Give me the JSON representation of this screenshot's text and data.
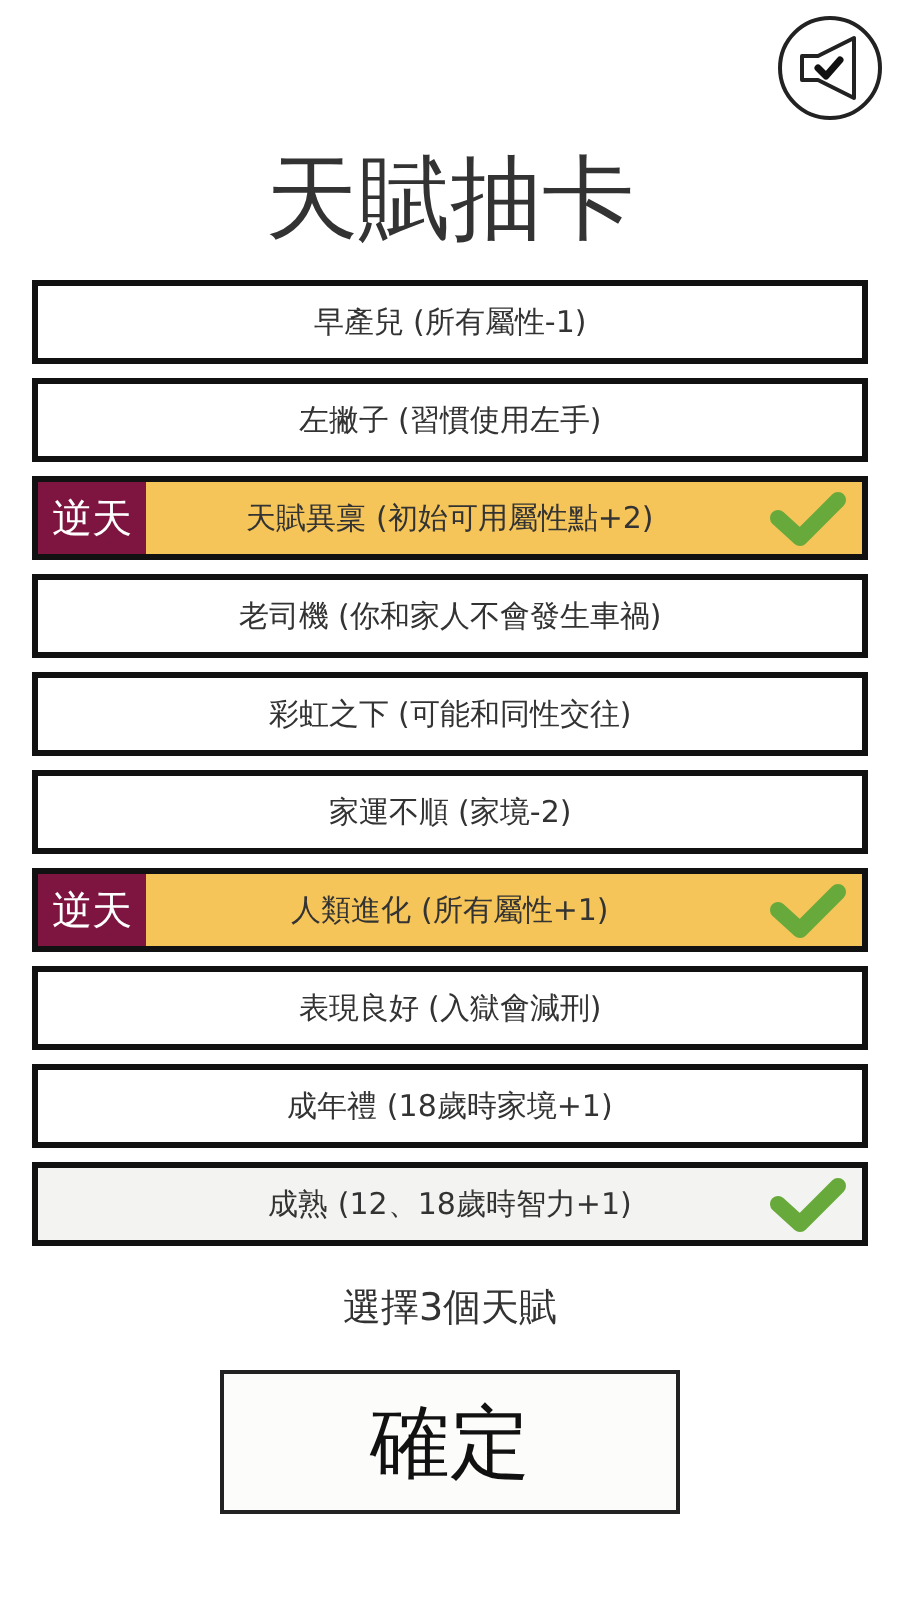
{
  "title": "天賦抽卡",
  "talents": [
    {
      "name": "早產兒 (所有屬性-1)",
      "kind": "normal",
      "selected": false
    },
    {
      "name": "左撇子 (習慣使用左手)",
      "kind": "normal",
      "selected": false
    },
    {
      "name": "天賦異稟 (初始可用屬性點+2)",
      "kind": "legendary",
      "badge": "逆天",
      "selected": true
    },
    {
      "name": "老司機 (你和家人不會發生車禍)",
      "kind": "normal",
      "selected": false
    },
    {
      "name": "彩虹之下 (可能和同性交往)",
      "kind": "normal",
      "selected": false
    },
    {
      "name": "家運不順 (家境-2)",
      "kind": "normal",
      "selected": false
    },
    {
      "name": "人類進化 (所有屬性+1)",
      "kind": "legendary",
      "badge": "逆天",
      "selected": true
    },
    {
      "name": "表現良好 (入獄會減刑)",
      "kind": "normal",
      "selected": false
    },
    {
      "name": "成年禮 (18歲時家境+1)",
      "kind": "normal",
      "selected": false
    },
    {
      "name": "成熟 (12、18歲時智力+1)",
      "kind": "normal",
      "selected": true
    }
  ],
  "hint": "選擇3個天賦",
  "confirm_button": "確定"
}
